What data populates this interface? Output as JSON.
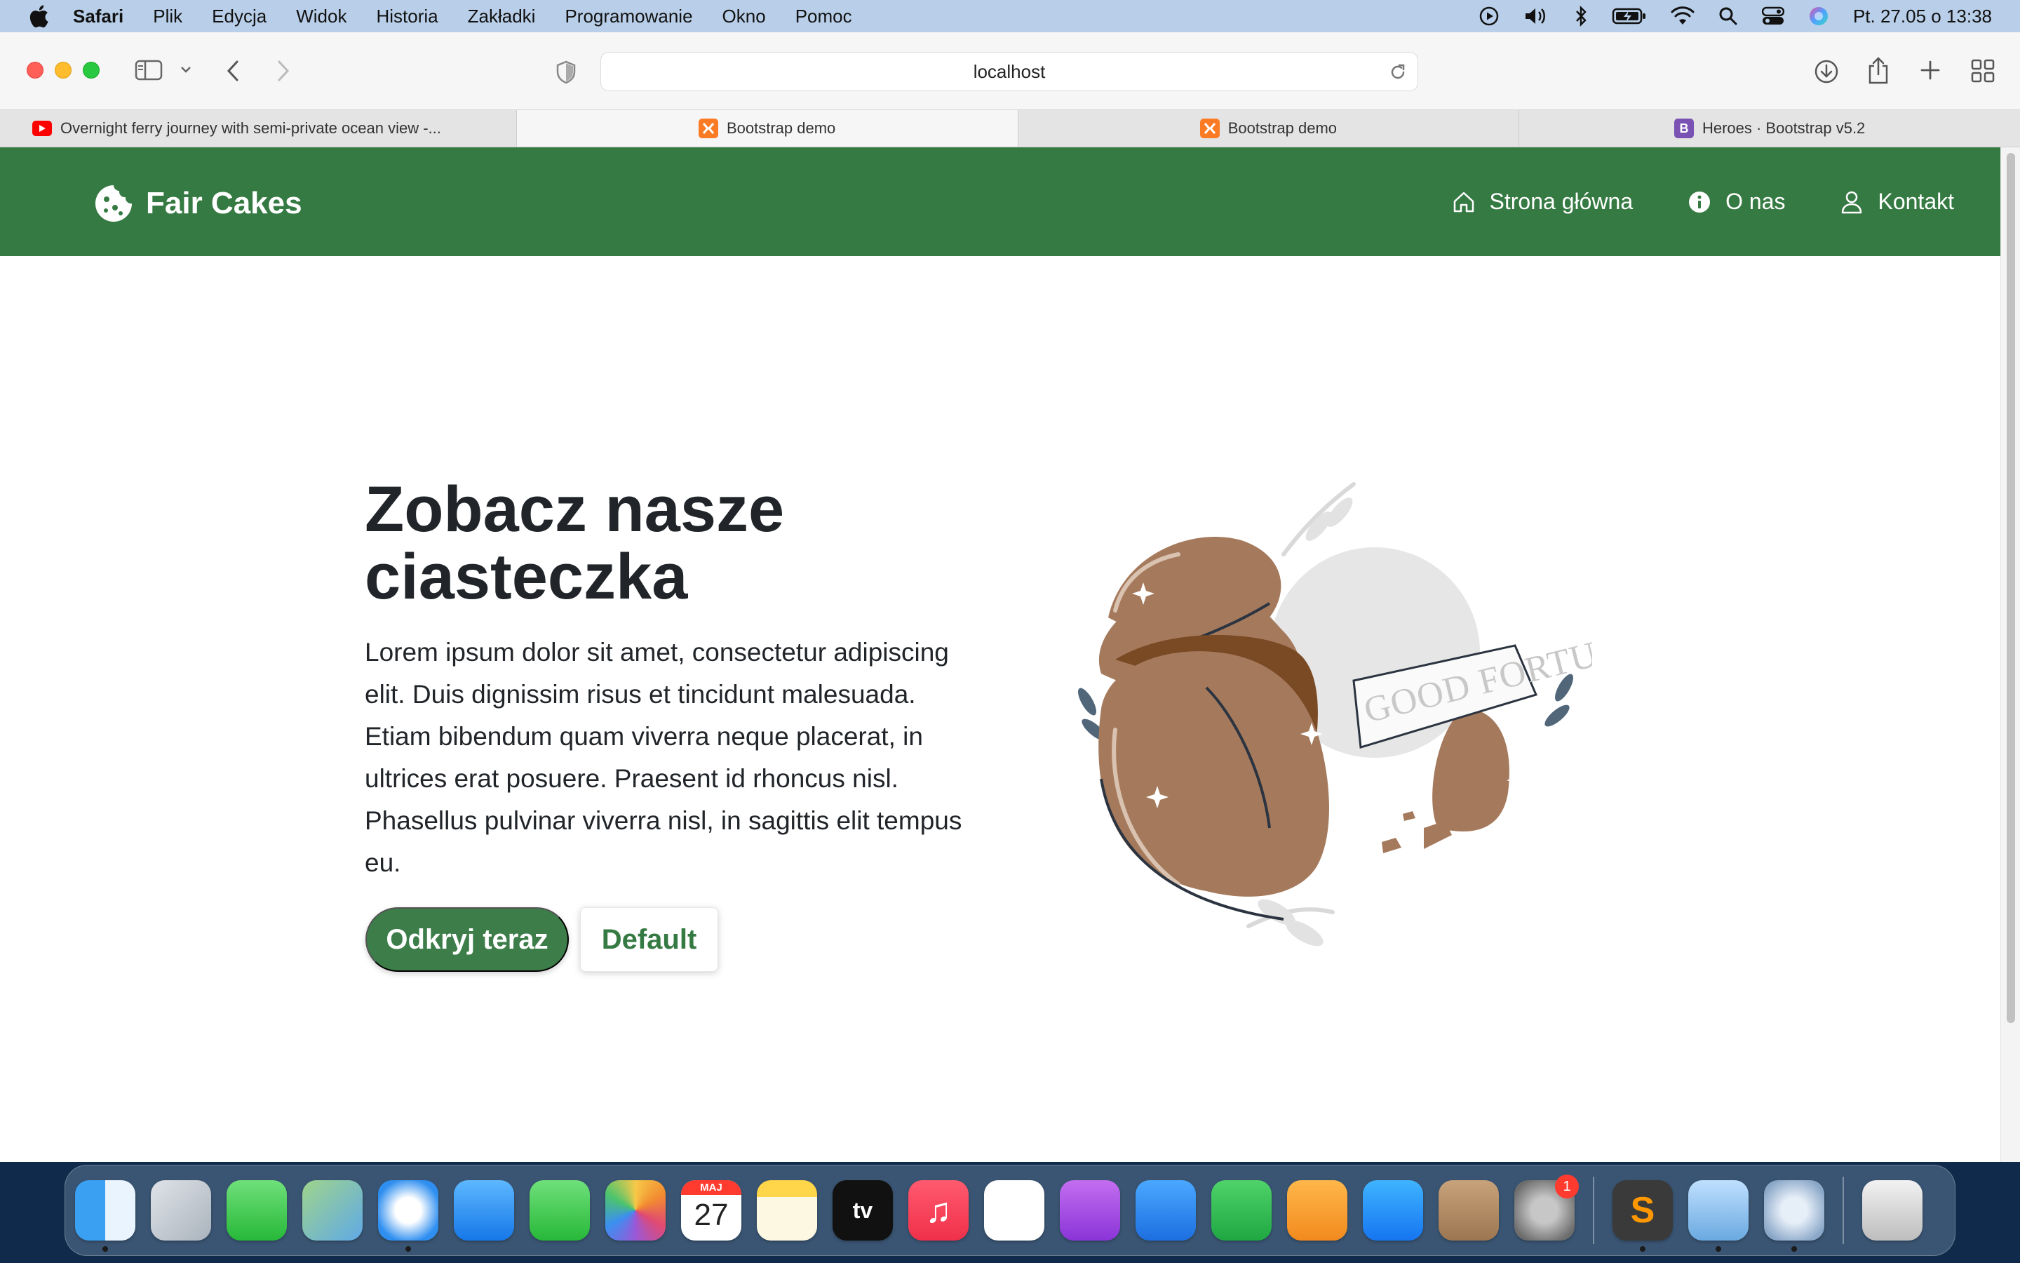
{
  "menubar": {
    "app": "Safari",
    "items": [
      "Plik",
      "Edycja",
      "Widok",
      "Historia",
      "Zakładki",
      "Programowanie",
      "Okno",
      "Pomoc"
    ],
    "clock": "Pt. 27.05 o 13:38"
  },
  "browser": {
    "address": "localhost",
    "tabs": [
      {
        "title": "Overnight ferry journey with semi-private ocean view -...",
        "icon": "youtube-favicon"
      },
      {
        "title": "Bootstrap demo",
        "icon": "xampp-favicon"
      },
      {
        "title": "Bootstrap demo",
        "icon": "xampp-favicon"
      },
      {
        "title": "Heroes · Bootstrap v5.2",
        "icon": "bootstrap-favicon",
        "icon_letter": "B"
      }
    ]
  },
  "navbar": {
    "brand": "Fair Cakes",
    "links": [
      {
        "label": "Strona główna",
        "icon": "home-icon"
      },
      {
        "label": "O nas",
        "icon": "info-icon"
      },
      {
        "label": "Kontakt",
        "icon": "person-icon"
      }
    ]
  },
  "hero": {
    "title": "Zobacz nasze ciasteczka",
    "text": "Lorem ipsum dolor sit amet, consectetur adipiscing elit. Duis dignissim risus et tincidunt malesuada. Etiam bibendum quam viverra neque placerat, in ultrices erat posuere. Praesent id rhoncus nisl. Phasellus pulvinar viverra nisl, in sagittis elit tempus eu.",
    "primary_button": "Odkryj teraz",
    "secondary_button": "Default",
    "illustration_text": "GOOD FORTUNE"
  },
  "dock": {
    "calendar_month": "MAJ",
    "calendar_day": "27",
    "tv_label": "tv",
    "settings_badge": "1"
  },
  "colors": {
    "navbar": "#367a43",
    "primary": "#3c7d49",
    "cookie": "#a57a5c"
  }
}
